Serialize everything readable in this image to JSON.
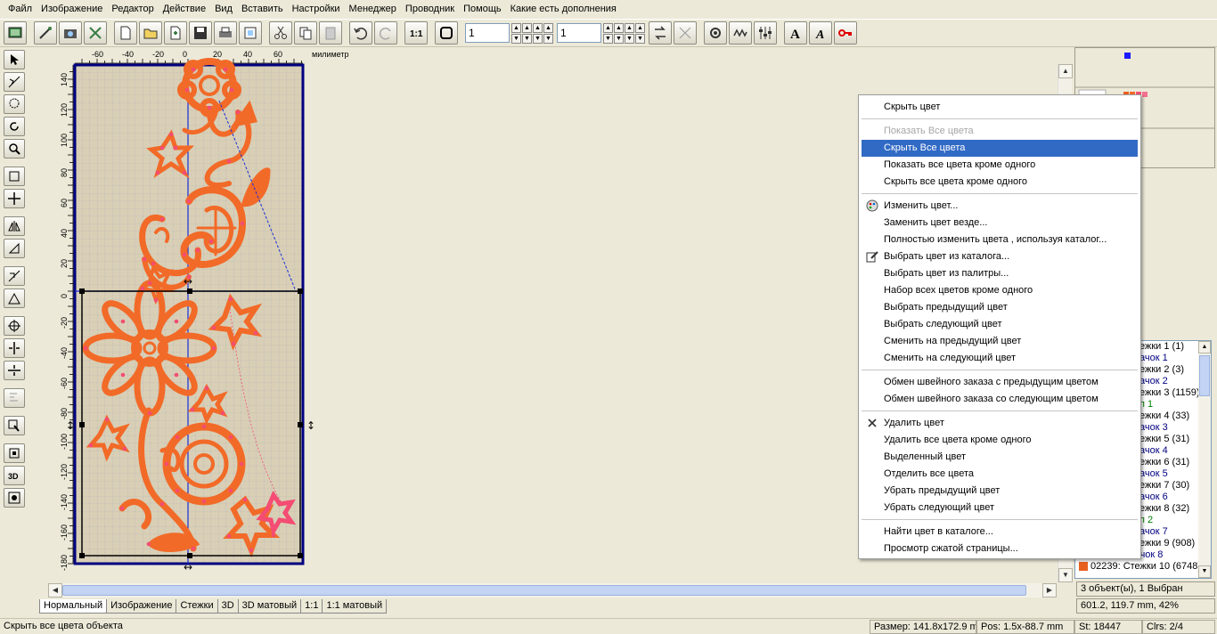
{
  "menubar": [
    "Файл",
    "Изображение",
    "Редактор",
    "Действие",
    "Вид",
    "Вставить",
    "Настройки",
    "Менеджер",
    "Проводник",
    "Помощь",
    "Какие есть дополнения"
  ],
  "toolbar": {
    "spin1": "1",
    "spin2": "1"
  },
  "ruler": {
    "unit": "милиметр",
    "h_ticks": [
      "-60",
      "-40",
      "-20",
      "0",
      "20",
      "40",
      "60"
    ],
    "v_ticks": [
      "140",
      "120",
      "100",
      "80",
      "60",
      "40",
      "20",
      "0",
      "-20",
      "-40",
      "-60",
      "-80",
      "-100",
      "-120",
      "-140",
      "-160",
      "-180"
    ]
  },
  "context_menu": [
    {
      "label": "Скрыть цвет",
      "state": "normal"
    },
    {
      "sep": true
    },
    {
      "label": "Показать Все цвета",
      "state": "disabled"
    },
    {
      "label": "Скрыть Все цвета",
      "state": "highlighted"
    },
    {
      "label": "Показать все цвета кроме одного",
      "state": "normal"
    },
    {
      "label": "Скрыть все цвета кроме одного",
      "state": "normal"
    },
    {
      "sep": true
    },
    {
      "label": "Изменить цвет...",
      "state": "normal",
      "icon": "palette-icon"
    },
    {
      "label": "Заменить цвет везде...",
      "state": "normal"
    },
    {
      "label": "Полностью изменить цвета , используя каталог...",
      "state": "normal"
    },
    {
      "label": "Выбрать цвет из каталога...",
      "state": "normal",
      "icon": "catalog-pencil-icon"
    },
    {
      "label": "Выбрать цвет из палитры...",
      "state": "normal"
    },
    {
      "label": "Набор всех цветов кроме одного",
      "state": "normal"
    },
    {
      "label": "Выбрать предыдущий цвет",
      "state": "normal"
    },
    {
      "label": "Выбрать следующий цвет",
      "state": "normal"
    },
    {
      "label": "Сменить на предыдущий цвет",
      "state": "normal"
    },
    {
      "label": "Сменить на следующий цвет",
      "state": "normal"
    },
    {
      "sep": true
    },
    {
      "label": "Обмен швейного заказа с предыдущим цветом",
      "state": "normal"
    },
    {
      "label": "Обмен швейного заказа со следующим цветом",
      "state": "normal"
    },
    {
      "sep": true
    },
    {
      "label": "Удалить цвет",
      "state": "normal",
      "icon": "close-x-icon"
    },
    {
      "label": "Удалить все цвета кроме одного",
      "state": "normal"
    },
    {
      "label": "Выделенный цвет",
      "state": "normal"
    },
    {
      "label": "Отделить все цвета",
      "state": "normal"
    },
    {
      "label": "Убрать предыдущий цвет",
      "state": "normal"
    },
    {
      "label": "Убрать следующий цвет",
      "state": "normal"
    },
    {
      "sep": true
    },
    {
      "label": "Найти цвет в каталоге...",
      "state": "normal"
    },
    {
      "label": "Просмотр сжатой страницы...",
      "state": "normal"
    }
  ],
  "object_list": [
    {
      "text": "ежки 1 (1)",
      "kind": "normal"
    },
    {
      "text": "ачок 1",
      "kind": "blue"
    },
    {
      "text": "ежки 2 (3)",
      "kind": "normal"
    },
    {
      "text": "ачок 2",
      "kind": "blue"
    },
    {
      "text": "ежки 3 (1159)",
      "kind": "normal"
    },
    {
      "text": "п 1",
      "kind": "green"
    },
    {
      "text": "ежки 4 (33)",
      "kind": "normal"
    },
    {
      "text": "ачок 3",
      "kind": "blue"
    },
    {
      "text": "ежки 5 (31)",
      "kind": "normal"
    },
    {
      "text": "ачок 4",
      "kind": "blue"
    },
    {
      "text": "ежки 6 (31)",
      "kind": "normal"
    },
    {
      "text": "ачок 5",
      "kind": "blue"
    },
    {
      "text": "ежки 7 (30)",
      "kind": "normal"
    },
    {
      "text": "ачок 6",
      "kind": "blue"
    },
    {
      "text": "ежки 8 (32)",
      "kind": "normal"
    },
    {
      "text": "п 2",
      "kind": "green"
    },
    {
      "text": "ачок 7",
      "kind": "blue"
    },
    {
      "text": "ежки 9 (908)",
      "kind": "normal"
    },
    {
      "text": "02239:  Скачок 8",
      "kind": "blue"
    },
    {
      "text": "02239:  Стежки 10 (6748)",
      "kind": "normal"
    }
  ],
  "rp_status": {
    "selection": "3 объект(ы), 1 Выбран",
    "coords": "601.2, 119.7 mm, 42%"
  },
  "tabs": [
    "Нормальный",
    "Изображение",
    "Стежки",
    "3D",
    "3D матовый",
    "1:1",
    "1:1 матовый"
  ],
  "status": {
    "hint": "Скрыть все цвета объекта",
    "size": "Размер: 141.8x172.9 mm",
    "pos": "Pos: 1.5x-88.7 mm",
    "stitches": "St: 18447",
    "colors": "Clrs: 2/4"
  },
  "colors": {
    "embroidery": "#f26a28",
    "accent_pink": "#f44c72",
    "hoop": "#000080",
    "highlight": "#316ac5",
    "swatch": "#e8601e"
  }
}
